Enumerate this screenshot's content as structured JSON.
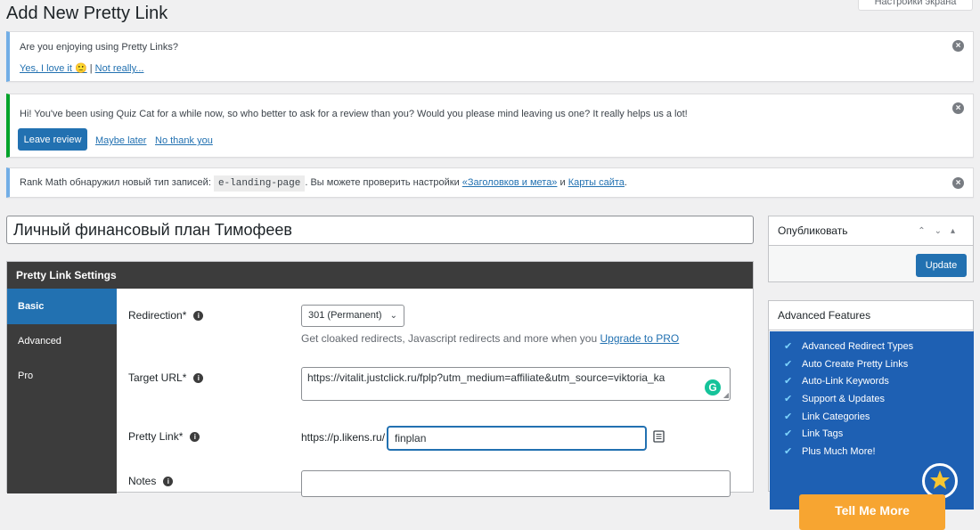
{
  "page": {
    "title": "Add New Pretty Link",
    "screen_options": "Настройки экрана"
  },
  "notices": {
    "enjoy": {
      "question": "Are you enjoying using Pretty Links?",
      "yes": "Yes, I love it 🙂",
      "separator": "|",
      "no": "Not really..."
    },
    "quizcat": {
      "message": "Hi! You've been using Quiz Cat for a while now, so who better to ask for a review than you? Would you please mind leaving us one? It really helps us a lot!",
      "leave_review": "Leave review",
      "maybe_later": "Maybe later",
      "no_thanks": "No thank you"
    },
    "rankmath": {
      "text_before": "Rank Math обнаружил новый тип записей:",
      "post_type": "e-landing-page",
      "text_middle": ". Вы можете проверить настройки",
      "link_titles": "«Заголовков и мета»",
      "and": "и",
      "link_sitemap": "Карты сайта",
      "end": "."
    },
    "dismiss": "×"
  },
  "post": {
    "title": "Личный финансовый план Тимофеев"
  },
  "settings": {
    "header": "Pretty Link Settings",
    "tabs": [
      "Basic",
      "Advanced",
      "Pro"
    ],
    "redirection": {
      "label": "Redirection*",
      "value": "301 (Permanent)",
      "desc_text": "Get cloaked redirects, Javascript redirects and more when you",
      "desc_link": "Upgrade to PRO"
    },
    "target_url": {
      "label": "Target URL*",
      "value": "https://vitalit.justclick.ru/fplp?utm_medium=affiliate&utm_source=viktoria_ka"
    },
    "pretty_link": {
      "label": "Pretty Link*",
      "base": "https://p.likens.ru/",
      "slug": "finplan"
    },
    "notes": {
      "label": "Notes"
    },
    "info": "i"
  },
  "publish": {
    "title": "Опубликовать",
    "update": "Update"
  },
  "advanced_features": {
    "title": "Advanced Features",
    "items": [
      "Advanced Redirect Types",
      "Auto Create Pretty Links",
      "Auto-Link Keywords",
      "Support & Updates",
      "Link Categories",
      "Link Tags",
      "Plus Much More!"
    ],
    "cta": "Tell Me More"
  },
  "colors": {
    "primary": "#2271b1",
    "dark_panel": "#3c3c3c",
    "promo_blue": "#1e60b3",
    "cta_orange": "#f7a531",
    "notice_info": "#72aee6",
    "notice_success": "#00a32a"
  },
  "icons": {
    "dismiss": "dismiss-icon",
    "info": "info-icon",
    "copy": "clipboard-icon",
    "grammarly": "grammarly-icon",
    "check": "checkmark-icon"
  }
}
